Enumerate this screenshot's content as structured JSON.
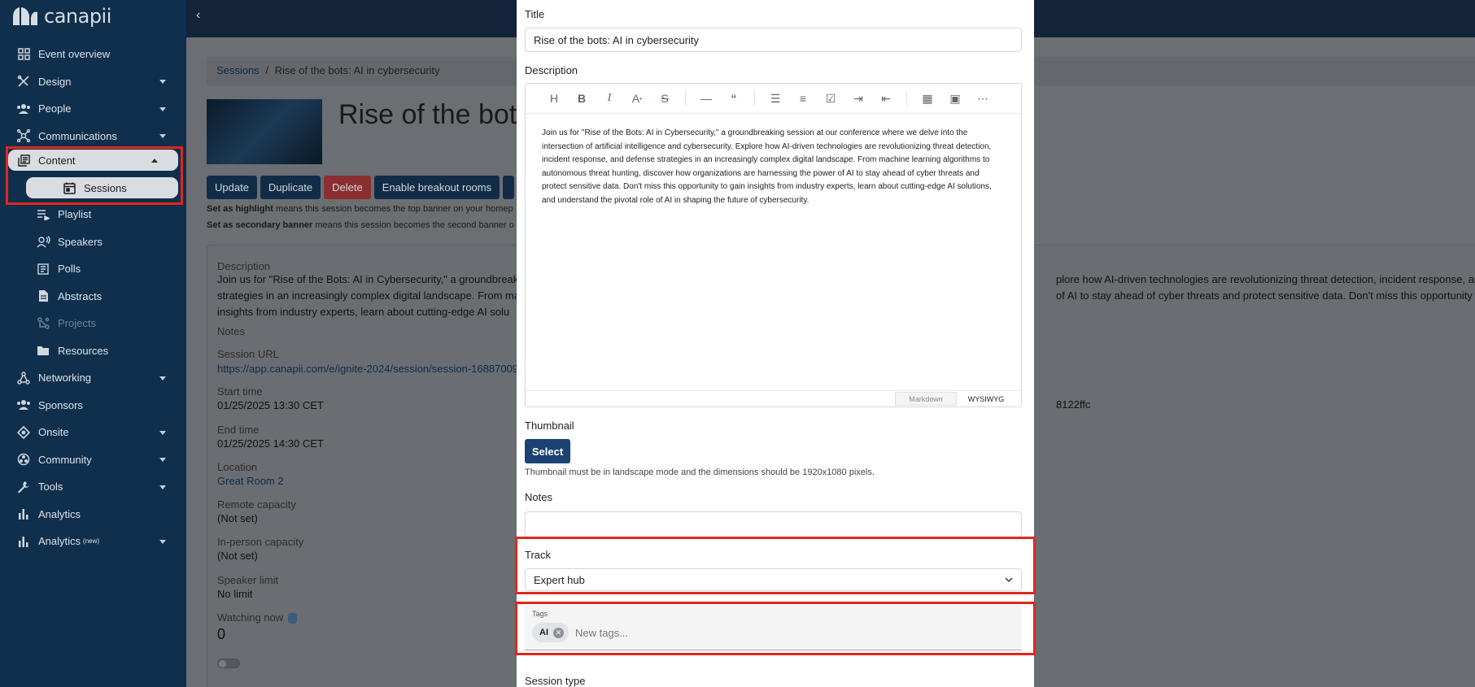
{
  "app": {
    "logo_text": "canapii"
  },
  "sidebar": {
    "items": [
      {
        "label": "Event overview",
        "icon": "grid-icon"
      },
      {
        "label": "Design",
        "icon": "design-tools-icon"
      },
      {
        "label": "People",
        "icon": "people-icon"
      },
      {
        "label": "Communications",
        "icon": "hub-icon"
      },
      {
        "label": "Content",
        "icon": "library-icon"
      },
      {
        "label": "Sessions",
        "icon": "calendar-icon"
      },
      {
        "label": "Playlist",
        "icon": "playlist-icon"
      },
      {
        "label": "Speakers",
        "icon": "speaker-icon"
      },
      {
        "label": "Polls",
        "icon": "poll-icon"
      },
      {
        "label": "Abstracts",
        "icon": "document-icon"
      },
      {
        "label": "Projects",
        "icon": "project-icon"
      },
      {
        "label": "Resources",
        "icon": "folder-icon"
      },
      {
        "label": "Networking",
        "icon": "network-icon"
      },
      {
        "label": "Sponsors",
        "icon": "sponsors-icon"
      },
      {
        "label": "Onsite",
        "icon": "diamond-icon"
      },
      {
        "label": "Community",
        "icon": "community-icon"
      },
      {
        "label": "Tools",
        "icon": "wrench-icon"
      },
      {
        "label": "Analytics",
        "icon": "bar-chart-icon"
      },
      {
        "label": "Analytics",
        "icon": "bar-chart-icon",
        "superscript": "(new)"
      }
    ]
  },
  "background": {
    "breadcrumb": {
      "root": "Sessions",
      "separator": "/",
      "current": "Rise of the bots: AI in cybersecurity"
    },
    "title": "Rise of the bots",
    "buttons": [
      "Update",
      "Duplicate",
      "Delete",
      "Enable breakout rooms"
    ],
    "notes": [
      {
        "bold": "Set as highlight",
        "text": " means this session becomes the top banner on your homep"
      },
      {
        "bold": "Set as secondary banner",
        "text": " means this session becomes the second banner o"
      }
    ],
    "details": {
      "description_label": "Description",
      "description_lines": [
        "Join us for \"Rise of the Bots: AI in Cybersecurity,\" a groundbreak",
        "strategies in an increasingly complex digital landscape. From ma",
        "insights from industry experts, learn about cutting-edge AI solu"
      ],
      "description_right_lines": [
        "plore how AI-driven technologies are revolutionizing threat detection, incident response, and de",
        "of AI to stay ahead of cyber threats and protect sensitive data. Don't miss this opportunity to ga"
      ],
      "notes_label": "Notes",
      "session_url_label": "Session URL",
      "session_url": "https://app.canapii.com/e/ignite-2024/session/session-16887009",
      "session_url_tail": "8122ffc",
      "start_label": "Start time",
      "start_value": "01/25/2025 13:30 CET",
      "end_label": "End time",
      "end_value": "01/25/2025 14:30 CET",
      "location_label": "Location",
      "location_value": "Great Room 2",
      "remote_label": "Remote capacity",
      "remote_value": "(Not set)",
      "inperson_label": "In-person capacity",
      "inperson_value": "(Not set)",
      "speaker_limit_label": "Speaker limit",
      "speaker_limit_value": "No limit",
      "watching_label": "Watching now",
      "watching_value": "0"
    }
  },
  "modal": {
    "title_label": "Title",
    "title_value": "Rise of the bots: AI in cybersecurity",
    "description_label": "Description",
    "editor_text": "Join us for \"Rise of the Bots: AI in Cybersecurity,\" a groundbreaking session at our conference where we delve into the intersection of artificial intelligence and cybersecurity. Explore how AI-driven technologies are revolutionizing threat detection, incident response, and defense strategies in an increasingly complex digital landscape. From machine learning algorithms to autonomous threat hunting, discover how organizations are harnessing the power of AI to stay ahead of cyber threats and protect sensitive data. Don't miss this opportunity to gain insights from industry experts, learn about cutting-edge AI solutions, and understand the pivotal role of AI in shaping the future of cybersecurity.",
    "editor_modes": {
      "markdown": "Markdown",
      "wysiwyg": "WYSIWYG"
    },
    "thumbnail_label": "Thumbnail",
    "select_label": "Select",
    "thumbnail_help": "Thumbnail must be in landscape mode and the dimensions should be 1920x1080 pixels.",
    "notes_label": "Notes",
    "notes_value": "",
    "track_label": "Track",
    "track_value": "Expert hub",
    "tags_label": "Tags",
    "tags": [
      "AI"
    ],
    "tags_placeholder": "New tags...",
    "session_type_label": "Session type"
  },
  "colors": {
    "sidebar_bg": "#0f2f4c",
    "highlight": "#e2261d",
    "primary_button": "#1b4272"
  }
}
